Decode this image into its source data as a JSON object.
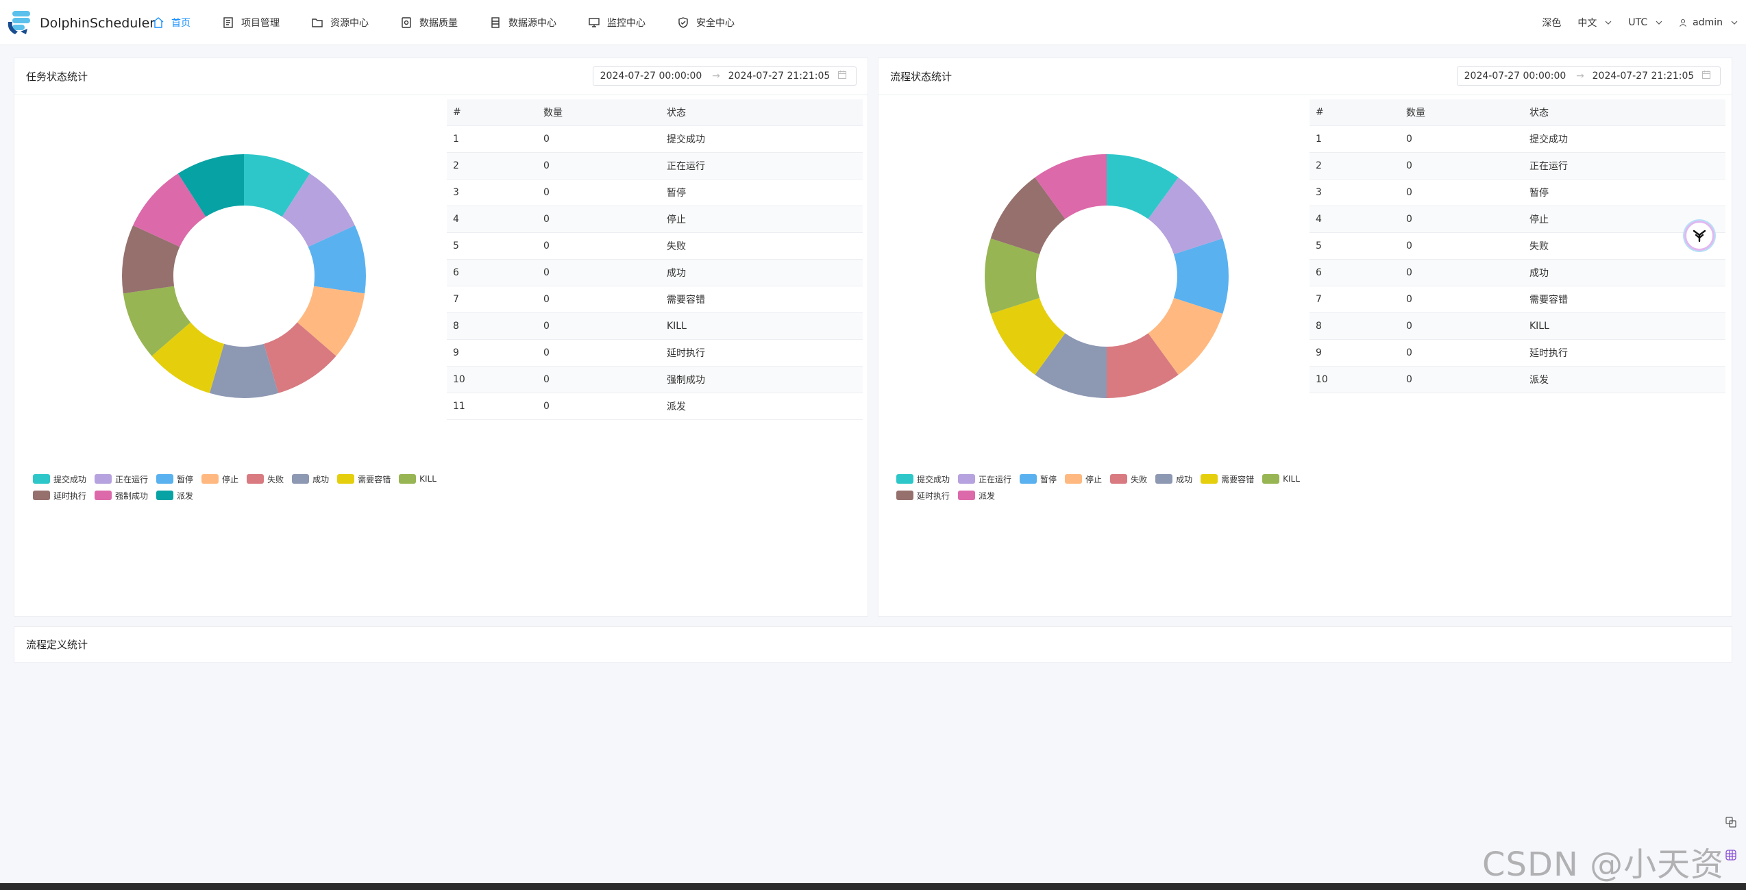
{
  "brand": {
    "name": "DolphinScheduler"
  },
  "nav": {
    "items": [
      {
        "label": "首页",
        "icon": "home-icon",
        "active": true
      },
      {
        "label": "项目管理",
        "icon": "project-icon",
        "active": false
      },
      {
        "label": "资源中心",
        "icon": "folder-icon",
        "active": false
      },
      {
        "label": "数据质量",
        "icon": "data-quality-icon",
        "active": false
      },
      {
        "label": "数据源中心",
        "icon": "datasource-icon",
        "active": false
      },
      {
        "label": "监控中心",
        "icon": "monitor-icon",
        "active": false
      },
      {
        "label": "安全中心",
        "icon": "shield-icon",
        "active": false
      }
    ],
    "theme_label": "深色",
    "language_label": "中文",
    "timezone_label": "UTC",
    "user_label": "admin"
  },
  "task_card": {
    "title": "任务状态统计",
    "date_start": "2024-07-27 00:00:00",
    "date_end": "2024-07-27 21:21:05"
  },
  "process_card": {
    "title": "流程状态统计",
    "date_start": "2024-07-27 00:00:00",
    "date_end": "2024-07-27 21:21:05"
  },
  "definition_card": {
    "title": "流程定义统计"
  },
  "table_headers": {
    "index": "#",
    "count": "数量",
    "state": "状态"
  },
  "colors": [
    "#2ec7c9",
    "#b6a2de",
    "#5ab1ef",
    "#ffb980",
    "#d87a80",
    "#8d98b3",
    "#e5cf0d",
    "#97b552",
    "#95706d",
    "#dc69aa",
    "#07a2a4"
  ],
  "chart_data": [
    {
      "type": "pie",
      "series": [
        {
          "name": "提交成功",
          "value": 0
        },
        {
          "name": "正在运行",
          "value": 0
        },
        {
          "name": "暂停",
          "value": 0
        },
        {
          "name": "停止",
          "value": 0
        },
        {
          "name": "失败",
          "value": 0
        },
        {
          "name": "成功",
          "value": 0
        },
        {
          "name": "需要容错",
          "value": 0
        },
        {
          "name": "KILL",
          "value": 0
        },
        {
          "name": "延时执行",
          "value": 0
        },
        {
          "name": "强制成功",
          "value": 0
        },
        {
          "name": "派发",
          "value": 0
        }
      ]
    },
    {
      "type": "pie",
      "series": [
        {
          "name": "提交成功",
          "value": 0
        },
        {
          "name": "正在运行",
          "value": 0
        },
        {
          "name": "暂停",
          "value": 0
        },
        {
          "name": "停止",
          "value": 0
        },
        {
          "name": "失败",
          "value": 0
        },
        {
          "name": "成功",
          "value": 0
        },
        {
          "name": "需要容错",
          "value": 0
        },
        {
          "name": "KILL",
          "value": 0
        },
        {
          "name": "延时执行",
          "value": 0
        },
        {
          "name": "派发",
          "value": 0
        }
      ]
    }
  ],
  "watermark": "CSDN @小天资源"
}
